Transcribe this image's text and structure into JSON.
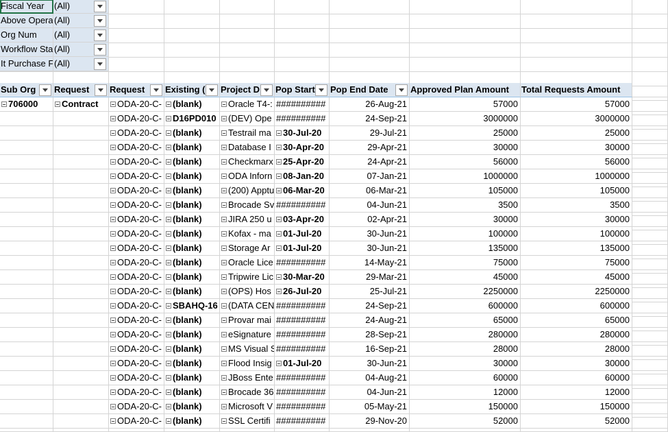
{
  "filters": [
    {
      "label": "Fiscal Year",
      "value": "(All)"
    },
    {
      "label": "Above Opera",
      "value": "(All)"
    },
    {
      "label": "Org Num",
      "value": "(All)"
    },
    {
      "label": "Workflow Sta",
      "value": "(All)"
    },
    {
      "label": "It Purchase F",
      "value": "(All)"
    }
  ],
  "headers": [
    "Sub Org",
    "Request",
    "Request",
    "Existing (",
    "Project D",
    "Pop Start",
    "Pop End Date",
    "Approved Plan Amount",
    "Total Requests Amount"
  ],
  "rows": [
    {
      "sub_org": "706000",
      "request_type": "Contract",
      "request": "ODA-20-C-",
      "existing": "(blank)",
      "project": "Oracle T4-:",
      "pop_start": "##########",
      "pop_end": "26-Aug-21",
      "approved": "57000",
      "total": "57000"
    },
    {
      "sub_org": "",
      "request_type": "",
      "request": "ODA-20-C-",
      "existing": "D16PD010",
      "project": "(DEV) Ope",
      "pop_start": "##########",
      "pop_end": "24-Sep-21",
      "approved": "3000000",
      "total": "3000000"
    },
    {
      "sub_org": "",
      "request_type": "",
      "request": "ODA-20-C-",
      "existing": "(blank)",
      "project": "Testrail ma",
      "pop_start": "30-Jul-20",
      "pop_end": "29-Jul-21",
      "approved": "25000",
      "total": "25000"
    },
    {
      "sub_org": "",
      "request_type": "",
      "request": "ODA-20-C-",
      "existing": "(blank)",
      "project": "Database I",
      "pop_start": "30-Apr-20",
      "pop_end": "29-Apr-21",
      "approved": "30000",
      "total": "30000"
    },
    {
      "sub_org": "",
      "request_type": "",
      "request": "ODA-20-C-",
      "existing": "(blank)",
      "project": "Checkmarx",
      "pop_start": "25-Apr-20",
      "pop_end": "24-Apr-21",
      "approved": "56000",
      "total": "56000"
    },
    {
      "sub_org": "",
      "request_type": "",
      "request": "ODA-20-C-",
      "existing": "(blank)",
      "project": "ODA Inforn",
      "pop_start": "08-Jan-20",
      "pop_end": "07-Jan-21",
      "approved": "1000000",
      "total": "1000000"
    },
    {
      "sub_org": "",
      "request_type": "",
      "request": "ODA-20-C-",
      "existing": "(blank)",
      "project": "(200) Apptu",
      "pop_start": "06-Mar-20",
      "pop_end": "06-Mar-21",
      "approved": "105000",
      "total": "105000"
    },
    {
      "sub_org": "",
      "request_type": "",
      "request": "ODA-20-C-",
      "existing": "(blank)",
      "project": "Brocade Sv",
      "pop_start": "##########",
      "pop_end": "04-Jun-21",
      "approved": "3500",
      "total": "3500"
    },
    {
      "sub_org": "",
      "request_type": "",
      "request": "ODA-20-C-",
      "existing": "(blank)",
      "project": "JIRA 250 u",
      "pop_start": "03-Apr-20",
      "pop_end": "02-Apr-21",
      "approved": "30000",
      "total": "30000"
    },
    {
      "sub_org": "",
      "request_type": "",
      "request": "ODA-20-C-",
      "existing": "(blank)",
      "project": "Kofax - ma",
      "pop_start": "01-Jul-20",
      "pop_end": "30-Jun-21",
      "approved": "100000",
      "total": "100000"
    },
    {
      "sub_org": "",
      "request_type": "",
      "request": "ODA-20-C-",
      "existing": "(blank)",
      "project": "Storage Ar",
      "pop_start": "01-Jul-20",
      "pop_end": "30-Jun-21",
      "approved": "135000",
      "total": "135000"
    },
    {
      "sub_org": "",
      "request_type": "",
      "request": "ODA-20-C-",
      "existing": "(blank)",
      "project": "Oracle Lice",
      "pop_start": "##########",
      "pop_end": "14-May-21",
      "approved": "75000",
      "total": "75000"
    },
    {
      "sub_org": "",
      "request_type": "",
      "request": "ODA-20-C-",
      "existing": "(blank)",
      "project": "Tripwire Lic",
      "pop_start": "30-Mar-20",
      "pop_end": "29-Mar-21",
      "approved": "45000",
      "total": "45000"
    },
    {
      "sub_org": "",
      "request_type": "",
      "request": "ODA-20-C-",
      "existing": "(blank)",
      "project": "(OPS) Hos",
      "pop_start": "26-Jul-20",
      "pop_end": "25-Jul-21",
      "approved": "2250000",
      "total": "2250000"
    },
    {
      "sub_org": "",
      "request_type": "",
      "request": "ODA-20-C-",
      "existing": "SBAHQ-16",
      "project": "(DATA CEN",
      "pop_start": "##########",
      "pop_end": "24-Sep-21",
      "approved": "600000",
      "total": "600000"
    },
    {
      "sub_org": "",
      "request_type": "",
      "request": "ODA-20-C-",
      "existing": "(blank)",
      "project": "Provar mai",
      "pop_start": "##########",
      "pop_end": "24-Aug-21",
      "approved": "65000",
      "total": "65000"
    },
    {
      "sub_org": "",
      "request_type": "",
      "request": "ODA-20-C-",
      "existing": "(blank)",
      "project": "eSignature",
      "pop_start": "##########",
      "pop_end": "28-Sep-21",
      "approved": "280000",
      "total": "280000"
    },
    {
      "sub_org": "",
      "request_type": "",
      "request": "ODA-20-C-",
      "existing": "(blank)",
      "project": "MS Visual S",
      "pop_start": "##########",
      "pop_end": "16-Sep-21",
      "approved": "28000",
      "total": "28000"
    },
    {
      "sub_org": "",
      "request_type": "",
      "request": "ODA-20-C-",
      "existing": "(blank)",
      "project": "Flood Insig",
      "pop_start": "01-Jul-20",
      "pop_end": "30-Jun-21",
      "approved": "30000",
      "total": "30000"
    },
    {
      "sub_org": "",
      "request_type": "",
      "request": "ODA-20-C-",
      "existing": "(blank)",
      "project": "JBoss Ente",
      "pop_start": "##########",
      "pop_end": "04-Aug-21",
      "approved": "60000",
      "total": "60000"
    },
    {
      "sub_org": "",
      "request_type": "",
      "request": "ODA-20-C-",
      "existing": "(blank)",
      "project": "Brocade 36",
      "pop_start": "##########",
      "pop_end": "04-Jun-21",
      "approved": "12000",
      "total": "12000"
    },
    {
      "sub_org": "",
      "request_type": "",
      "request": "ODA-20-C-",
      "existing": "(blank)",
      "project": "Microsoft V",
      "pop_start": "##########",
      "pop_end": "05-May-21",
      "approved": "150000",
      "total": "150000"
    },
    {
      "sub_org": "",
      "request_type": "",
      "request": "ODA-20-C-",
      "existing": "(blank)",
      "project": "SSL Certifi",
      "pop_start": "##########",
      "pop_end": "29-Nov-20",
      "approved": "52000",
      "total": "52000"
    }
  ]
}
